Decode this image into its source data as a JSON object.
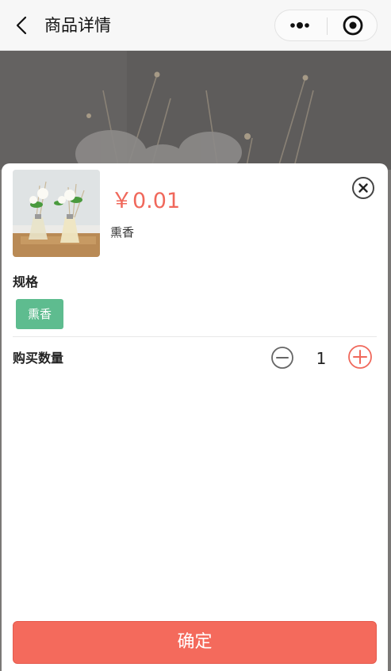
{
  "navbar": {
    "title": "商品详情",
    "back_icon": "chevron-left-icon",
    "more_icon": "more-dots-icon",
    "target_icon": "record-target-icon"
  },
  "product": {
    "price": "￥0.01",
    "name": "熏香",
    "image_icon": "product-photo-reed-diffuser"
  },
  "spec": {
    "label": "规格",
    "options": [
      "熏香"
    ],
    "selected": "熏香"
  },
  "quantity": {
    "label": "购买数量",
    "value": "1"
  },
  "confirm": {
    "label": "确定"
  },
  "colors": {
    "price": "#f0685b",
    "accent_green": "#5ebc8f",
    "confirm_bg": "#f46a5c"
  }
}
